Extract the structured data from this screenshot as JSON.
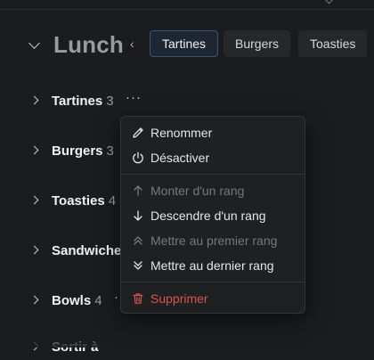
{
  "section": {
    "title": "Lunch"
  },
  "tabs": [
    {
      "label": "Tartines",
      "active": true
    },
    {
      "label": "Burgers",
      "active": false
    },
    {
      "label": "Toasties",
      "active": false
    }
  ],
  "rows": [
    {
      "name": "Tartines",
      "count": "3"
    },
    {
      "name": "Burgers",
      "count": "3"
    },
    {
      "name": "Toasties",
      "count": "4"
    },
    {
      "name": "Sandwiche",
      "count": ""
    },
    {
      "name": "Bowls",
      "count": "4"
    },
    {
      "name": "Sortir à",
      "count": ""
    }
  ],
  "menu": {
    "items": [
      {
        "label": "Renommer",
        "icon": "pencil-icon",
        "state": "enabled"
      },
      {
        "label": "Désactiver",
        "icon": "power-icon",
        "state": "enabled"
      },
      {
        "label": "Monter d'un rang",
        "icon": "arrow-up-icon",
        "state": "disabled"
      },
      {
        "label": "Descendre d'un rang",
        "icon": "arrow-down-icon",
        "state": "enabled"
      },
      {
        "label": "Mettre au premier rang",
        "icon": "double-chevron-up-icon",
        "state": "disabled"
      },
      {
        "label": "Mettre au dernier rang",
        "icon": "double-chevron-down-icon",
        "state": "enabled"
      },
      {
        "label": "Supprimer",
        "icon": "trash-icon",
        "state": "danger"
      }
    ]
  },
  "colors": {
    "background": "#1b1c1e",
    "active_tab_border": "#3a5275",
    "danger": "#d9534f"
  }
}
